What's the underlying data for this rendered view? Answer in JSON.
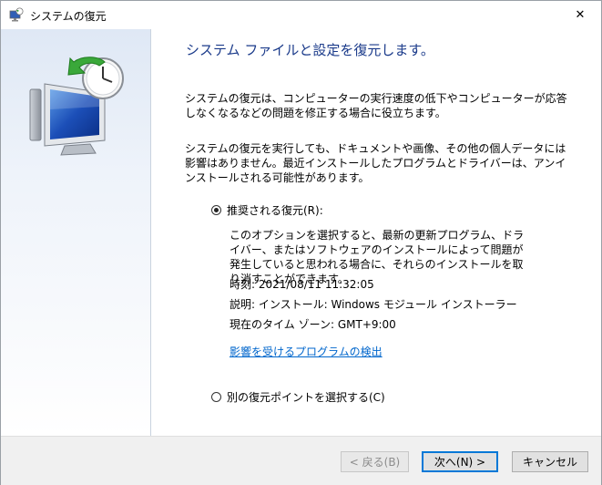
{
  "window": {
    "title": "システムの復元",
    "close_glyph": "✕"
  },
  "main": {
    "heading": "システム ファイルと設定を復元します。",
    "para1": "システムの復元は、コンピューターの実行速度の低下やコンピューターが応答しなくなるなどの問題を修正する場合に役立ちます。",
    "para2": "システムの復元を実行しても、ドキュメントや画像、その他の個人データには影響はありません。最近インストールしたプログラムとドライバーは、アンインストールされる可能性があります。",
    "options": {
      "recommended": {
        "label": "推奨される復元(R):",
        "selected": true,
        "description": "このオプションを選択すると、最新の更新プログラム、ドライバー、またはソフトウェアのインストールによって問題が発生していると思われる場合に、それらのインストールを取り消すことができます。",
        "time": "時刻: 2021/08/11 11:32:05",
        "explanation": "説明: インストール: Windows モジュール インストーラー",
        "timezone": "現在のタイム ゾーン: GMT+9:00",
        "scan_link": "影響を受けるプログラムの検出"
      },
      "other": {
        "label": "別の復元ポイントを選択する(C)",
        "selected": false
      }
    }
  },
  "footer": {
    "back_label": "< 戻る(B)",
    "next_label": "次へ(N) >",
    "cancel_label": "キャンセル"
  },
  "icons": {
    "app": "system-restore-icon",
    "hero": "system-restore-monitor-icon",
    "close": "close-icon"
  },
  "colors": {
    "heading": "#1a3a8a",
    "link": "#0066cc",
    "focus_border": "#0078d7"
  }
}
